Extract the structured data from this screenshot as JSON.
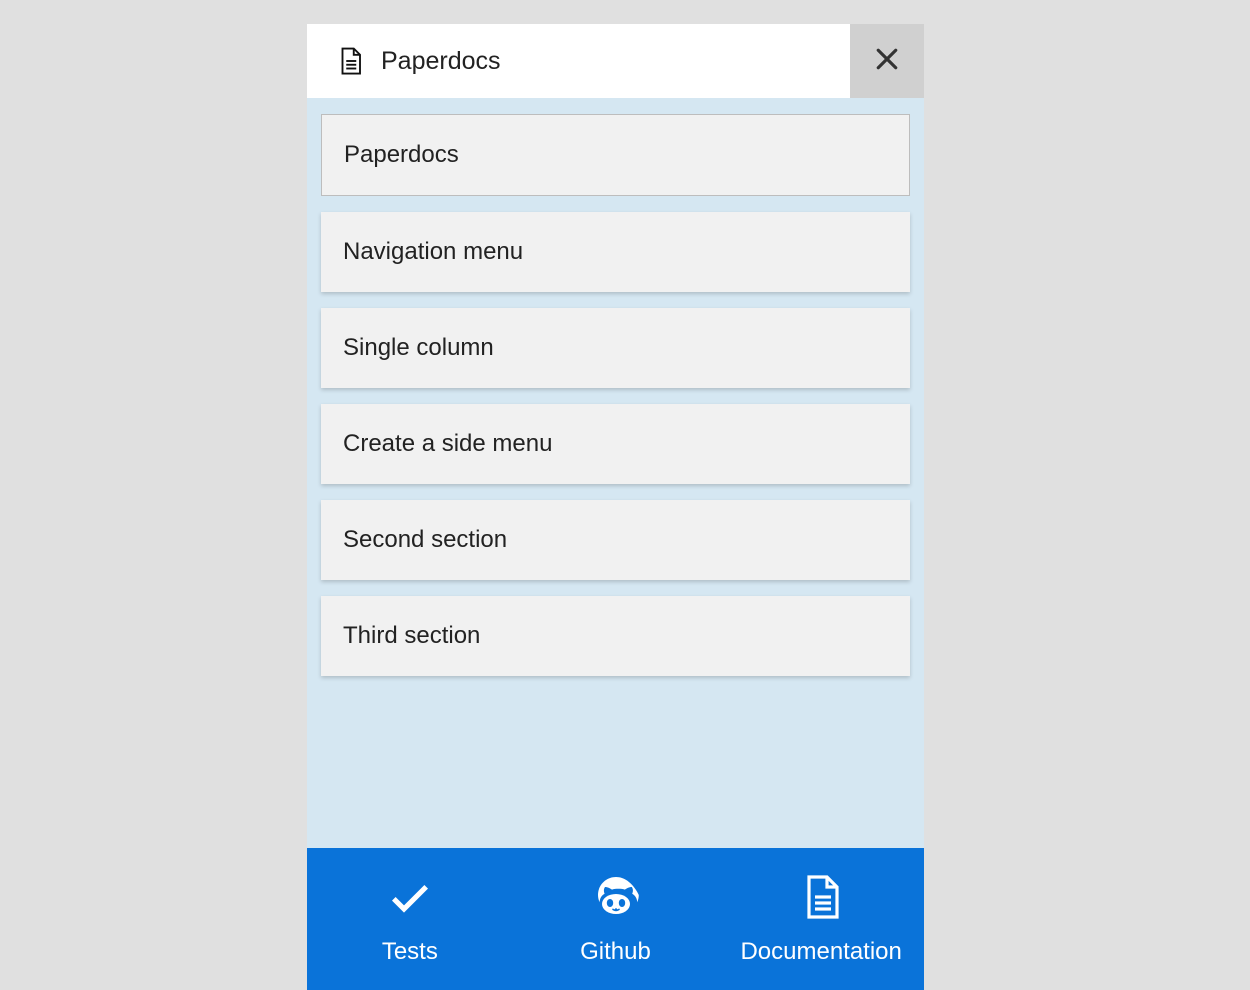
{
  "colors": {
    "accent": "#0a73d9",
    "panel": "#d5e7f2",
    "item_bg": "#f1f1f1",
    "page_bg": "#e0e0e0",
    "close_bg": "#d0d0d0"
  },
  "header": {
    "title": "Paperdocs",
    "icon_name": "document-icon",
    "close_icon_name": "cross-icon"
  },
  "menu": {
    "items": [
      {
        "label": "Paperdocs",
        "active": true
      },
      {
        "label": "Navigation menu",
        "active": false
      },
      {
        "label": "Single column",
        "active": false
      },
      {
        "label": "Create a side menu",
        "active": false
      },
      {
        "label": "Second section",
        "active": false
      },
      {
        "label": "Third section",
        "active": false
      }
    ]
  },
  "tabs": {
    "items": [
      {
        "label": "Tests",
        "icon_name": "check-icon"
      },
      {
        "label": "Github",
        "icon_name": "github-icon"
      },
      {
        "label": "Documentation",
        "icon_name": "document-icon"
      }
    ]
  }
}
